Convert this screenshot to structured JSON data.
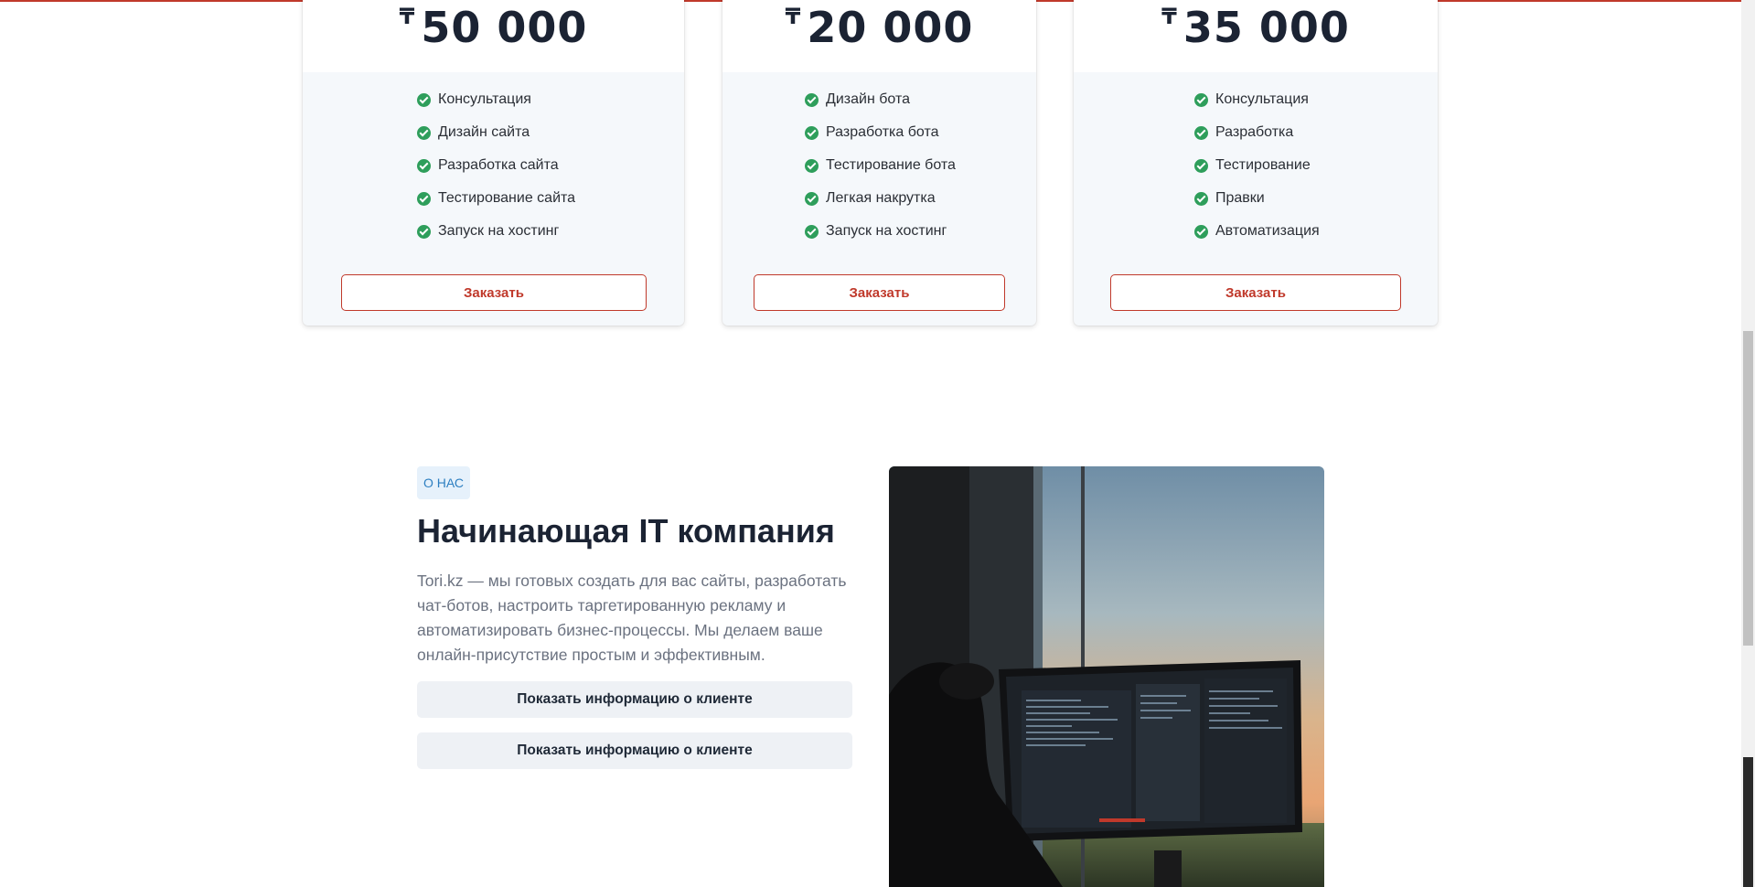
{
  "pricing": {
    "currency_symbol": "₸",
    "cards": [
      {
        "price": "50 000",
        "features": [
          "Консультация",
          "Дизайн сайта",
          "Разработка сайта",
          "Тестирование сайта",
          "Запуск на хостинг"
        ],
        "order_label": "Заказать"
      },
      {
        "price": "20 000",
        "features": [
          "Дизайн бота",
          "Разработка бота",
          "Тестирование бота",
          "Легкая накрутка",
          "Запуск на хостинг"
        ],
        "order_label": "Заказать"
      },
      {
        "price": "35 000",
        "features": [
          "Консультация",
          "Разработка",
          "Тестирование",
          "Правки",
          "Автоматизация"
        ],
        "order_label": "Заказать"
      }
    ]
  },
  "about": {
    "badge": "О НАС",
    "title": "Начинающая IT компания",
    "description": "Tori.kz — мы готовых создать для вас сайты, разработать чат-ботов, настроить таргетированную рекламу и автоматизировать бизнес-процессы. Мы делаем ваше онлайн-присутствие простым и эффективным.",
    "buttons": [
      "Показать информацию о клиенте",
      "Показать информацию о клиенте"
    ],
    "image_icon": "developer-at-monitor-photo"
  },
  "colors": {
    "accent": "#c0392b",
    "check": "#2e9e5b",
    "badge_text": "#2d7fc1",
    "badge_bg": "#e6f1fb"
  }
}
